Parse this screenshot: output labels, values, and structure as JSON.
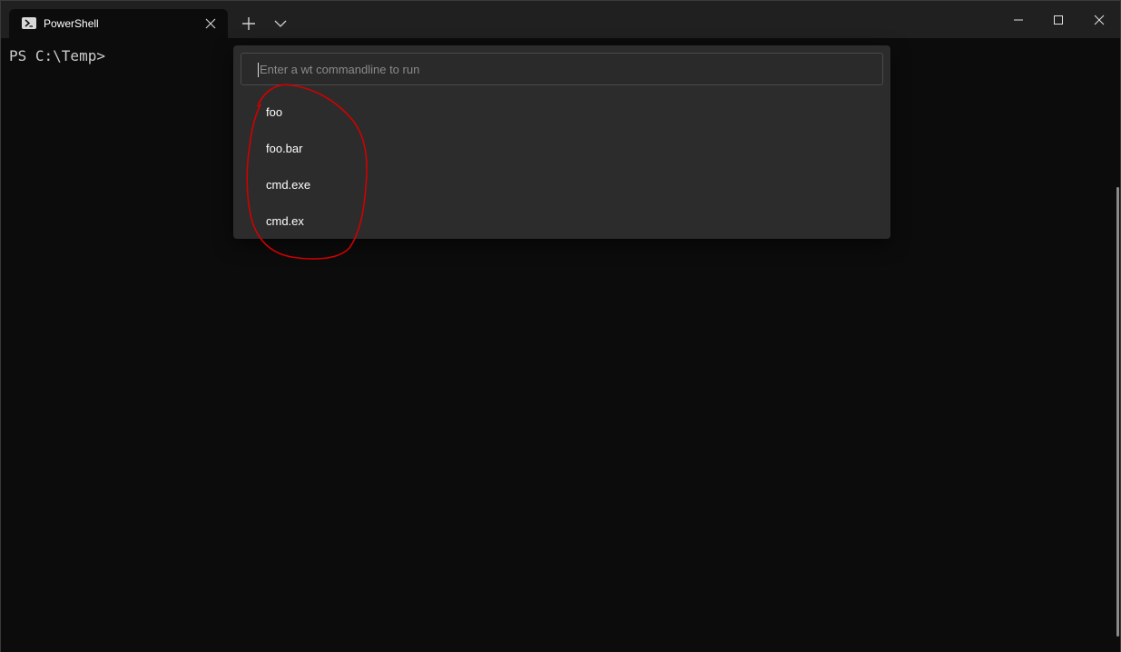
{
  "tab": {
    "title": "PowerShell",
    "icon": "powershell-icon"
  },
  "titlebar": {
    "new_tab_icon": "plus-icon",
    "dropdown_icon": "chevron-down-icon"
  },
  "window_controls": {
    "minimize": "minimize-icon",
    "maximize": "maximize-icon",
    "close": "close-icon"
  },
  "terminal": {
    "prompt": "PS C:\\Temp>"
  },
  "command_palette": {
    "input_placeholder": "Enter a wt commandline to run",
    "input_value": "",
    "suggestions": [
      "foo",
      "foo.bar",
      "cmd.exe",
      "cmd.ex"
    ]
  },
  "colors": {
    "background": "#0c0c0c",
    "titlebar": "#202020",
    "palette": "#2c2c2c",
    "annotation": "#d10000"
  }
}
